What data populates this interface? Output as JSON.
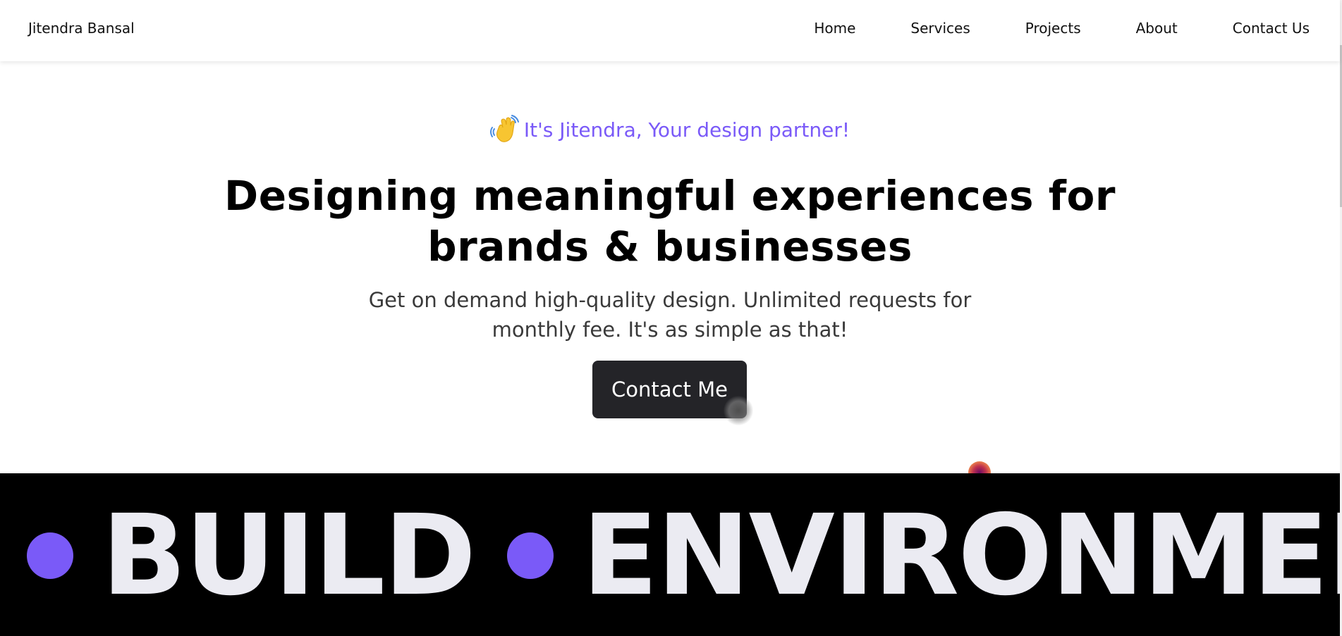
{
  "navbar": {
    "brand": "Jitendra Bansal",
    "links": [
      "Home",
      "Services",
      "Projects",
      "About",
      "Contact Us"
    ]
  },
  "hero": {
    "greeting_icon": "waving-hand-icon",
    "greeting": "It's Jitendra, Your design partner!",
    "headline": "Designing meaningful experiences for brands & businesses",
    "subtext": "Get on demand high-quality design. Unlimited requests for monthly fee. It's as simple as that!",
    "cta_label": "Contact Me"
  },
  "marquee": {
    "words": [
      "BUILD",
      "ENVIRONMEN"
    ]
  },
  "colors": {
    "accent": "#7a5af8",
    "button_bg": "#242428",
    "marquee_bg": "#000000",
    "marquee_text": "#ebebf2"
  }
}
